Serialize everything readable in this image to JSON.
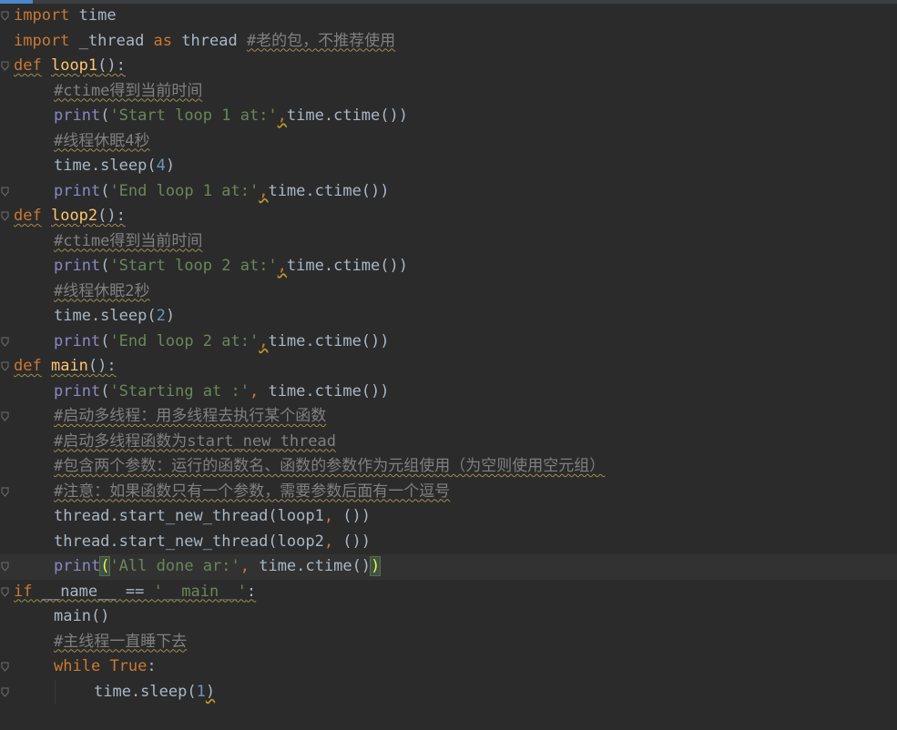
{
  "editor": {
    "language": "python",
    "current_line": 23,
    "lines": [
      {
        "fold": true,
        "indent": 0,
        "tokens": [
          {
            "t": "import",
            "c": "kw"
          },
          {
            "t": " time"
          }
        ]
      },
      {
        "fold": false,
        "indent": 0,
        "tokens": [
          {
            "t": "import",
            "c": "kw"
          },
          {
            "t": " _thread "
          },
          {
            "t": "as",
            "c": "kw"
          },
          {
            "t": " thread "
          },
          {
            "t": "#老的包，不推荐使用",
            "c": "cm",
            "u": true
          }
        ]
      },
      {
        "fold": true,
        "indent": 0,
        "tokens": [
          {
            "t": "def",
            "c": "kw",
            "u": true
          },
          {
            "t": " "
          },
          {
            "t": "loop1",
            "c": "fn",
            "u": true
          },
          {
            "t": "():",
            "u": true
          }
        ]
      },
      {
        "fold": false,
        "indent": 1,
        "tokens": [
          {
            "t": "#ctime得到当前时间",
            "c": "cm",
            "u": true
          }
        ]
      },
      {
        "fold": false,
        "indent": 1,
        "tokens": [
          {
            "t": "print",
            "c": "bi"
          },
          {
            "t": "("
          },
          {
            "t": "'Start loop 1 at:'",
            "c": "str"
          },
          {
            "t": ",",
            "c": "kw",
            "w": true
          },
          {
            "t": "time.ctime())"
          }
        ]
      },
      {
        "fold": false,
        "indent": 1,
        "tokens": [
          {
            "t": "#线程休眠4秒",
            "c": "cm",
            "u": true
          }
        ]
      },
      {
        "fold": false,
        "indent": 1,
        "tokens": [
          {
            "t": "time.sleep("
          },
          {
            "t": "4",
            "c": "num"
          },
          {
            "t": ")"
          }
        ]
      },
      {
        "fold": true,
        "indent": 1,
        "tokens": [
          {
            "t": "print",
            "c": "bi"
          },
          {
            "t": "("
          },
          {
            "t": "'End loop 1 at:'",
            "c": "str"
          },
          {
            "t": ",",
            "c": "kw",
            "w": true
          },
          {
            "t": "time.ctime())"
          }
        ]
      },
      {
        "fold": true,
        "indent": 0,
        "tokens": [
          {
            "t": "def",
            "c": "kw",
            "u": true
          },
          {
            "t": " "
          },
          {
            "t": "loop2",
            "c": "fn",
            "u": true
          },
          {
            "t": "():",
            "u": true
          }
        ]
      },
      {
        "fold": false,
        "indent": 1,
        "tokens": [
          {
            "t": "#ctime得到当前时间",
            "c": "cm",
            "u": true
          }
        ]
      },
      {
        "fold": false,
        "indent": 1,
        "tokens": [
          {
            "t": "print",
            "c": "bi"
          },
          {
            "t": "("
          },
          {
            "t": "'Start loop 2 at:'",
            "c": "str"
          },
          {
            "t": ",",
            "c": "kw",
            "w": true
          },
          {
            "t": "time.ctime())"
          }
        ]
      },
      {
        "fold": false,
        "indent": 1,
        "tokens": [
          {
            "t": "#线程休眠2秒",
            "c": "cm",
            "u": true
          }
        ]
      },
      {
        "fold": false,
        "indent": 1,
        "tokens": [
          {
            "t": "time.sleep("
          },
          {
            "t": "2",
            "c": "num"
          },
          {
            "t": ")"
          }
        ]
      },
      {
        "fold": true,
        "indent": 1,
        "tokens": [
          {
            "t": "print",
            "c": "bi"
          },
          {
            "t": "("
          },
          {
            "t": "'End loop 2 at:'",
            "c": "str"
          },
          {
            "t": ",",
            "c": "kw",
            "w": true
          },
          {
            "t": "time.ctime())"
          }
        ]
      },
      {
        "fold": true,
        "indent": 0,
        "tokens": [
          {
            "t": "def",
            "c": "kw",
            "u": true
          },
          {
            "t": " "
          },
          {
            "t": "main",
            "c": "fn",
            "u": true
          },
          {
            "t": "():",
            "u": true
          }
        ]
      },
      {
        "fold": false,
        "indent": 1,
        "tokens": [
          {
            "t": "print",
            "c": "bi"
          },
          {
            "t": "("
          },
          {
            "t": "'Starting at :'",
            "c": "str"
          },
          {
            "t": ", ",
            "c": "kw"
          },
          {
            "t": "time.ctime())"
          }
        ]
      },
      {
        "fold": true,
        "indent": 1,
        "tokens": [
          {
            "t": "#启动多线程：用多线程去执行某个函数",
            "c": "cm",
            "u": true
          }
        ]
      },
      {
        "fold": false,
        "indent": 1,
        "tokens": [
          {
            "t": "#启动多线程函数为start_new_thread",
            "c": "cm",
            "u": true
          }
        ]
      },
      {
        "fold": false,
        "indent": 1,
        "tokens": [
          {
            "t": "#包含两个参数：运行的函数名、函数的参数作为元组使用（为空则使用空元组）",
            "c": "cm",
            "u": true
          }
        ]
      },
      {
        "fold": true,
        "indent": 1,
        "tokens": [
          {
            "t": "#注意：如果函数只有一个参数，需要参数后面有一个逗号",
            "c": "cm",
            "u": true
          }
        ]
      },
      {
        "fold": false,
        "indent": 1,
        "tokens": [
          {
            "t": "thread.start_new_thread(loop1"
          },
          {
            "t": ", ",
            "c": "kw"
          },
          {
            "t": "())"
          }
        ]
      },
      {
        "fold": false,
        "indent": 1,
        "tokens": [
          {
            "t": "thread.start_new_thread(loop2"
          },
          {
            "t": ", ",
            "c": "kw"
          },
          {
            "t": "())"
          }
        ]
      },
      {
        "fold": true,
        "indent": 1,
        "tokens": [
          {
            "t": "print",
            "c": "bi"
          },
          {
            "t": "(",
            "c": "brace"
          },
          {
            "t": "'All done ar:'",
            "c": "str"
          },
          {
            "t": ", ",
            "c": "kw"
          },
          {
            "t": "time.ctime()"
          },
          {
            "t": ")",
            "c": "brace"
          }
        ]
      },
      {
        "fold": true,
        "indent": 0,
        "tokens": [
          {
            "t": "if",
            "c": "kw",
            "u": true
          },
          {
            "t": " __name__ == ",
            "u": true
          },
          {
            "t": "'__main__'",
            "c": "str",
            "u": true
          },
          {
            "t": ":",
            "u": true
          }
        ]
      },
      {
        "fold": false,
        "indent": 1,
        "tokens": [
          {
            "t": "main()"
          }
        ]
      },
      {
        "fold": false,
        "indent": 1,
        "tokens": [
          {
            "t": "#主线程一直睡下去",
            "c": "cm",
            "u": true
          }
        ]
      },
      {
        "fold": true,
        "indent": 1,
        "tokens": [
          {
            "t": "while",
            "c": "kw"
          },
          {
            "t": " "
          },
          {
            "t": "True",
            "c": "kw"
          },
          {
            "t": ":"
          }
        ]
      },
      {
        "fold": true,
        "indent": 2,
        "tokens": [
          {
            "t": "time.sleep("
          },
          {
            "t": "1",
            "c": "num"
          },
          {
            "t": ")",
            "w": true
          }
        ]
      }
    ]
  }
}
